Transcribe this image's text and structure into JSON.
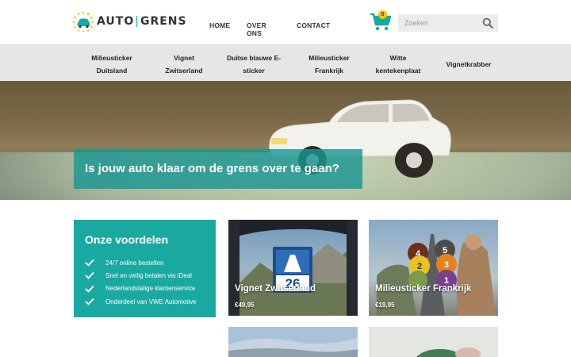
{
  "brand": {
    "name_left": "AUTO",
    "name_right": "GRENS",
    "accent": "#1aa9a1",
    "yellow": "#f6c400"
  },
  "nav": {
    "home": "HOME",
    "over": "OVER ONS",
    "contact": "CONTACT"
  },
  "cart": {
    "count": "0"
  },
  "search": {
    "placeholder": "Zoeken"
  },
  "categories": [
    {
      "line1": "Milieusticker",
      "line2": "Duitsland"
    },
    {
      "line1": "Vignet",
      "line2": "Zwitserland"
    },
    {
      "line1": "Duitse blauwe E-",
      "line2": "sticker"
    },
    {
      "line1": "Milieusticker",
      "line2": "Frankrijk"
    },
    {
      "line1": "Witte",
      "line2": "kentekenplaat"
    },
    {
      "line1": "Vignetkrabber",
      "line2": ""
    }
  ],
  "hero": {
    "caption": "Is jouw auto klaar om de grens over te gaan?"
  },
  "voordelen": {
    "title": "Onze voordelen",
    "items": [
      "24/7 online bestellen",
      "Snel en veilig betalen via iDeal",
      "Nederlandstalige klantenservice",
      "Onderdeel van VWE Automotive"
    ]
  },
  "products": [
    {
      "title": "Vignet Zwitserland",
      "price": "€49,95",
      "badge": "26"
    },
    {
      "title": "Milieusticker Frankrijk",
      "price": "€19,95",
      "badges": [
        "4",
        "5",
        "2",
        "3",
        "1"
      ]
    }
  ]
}
